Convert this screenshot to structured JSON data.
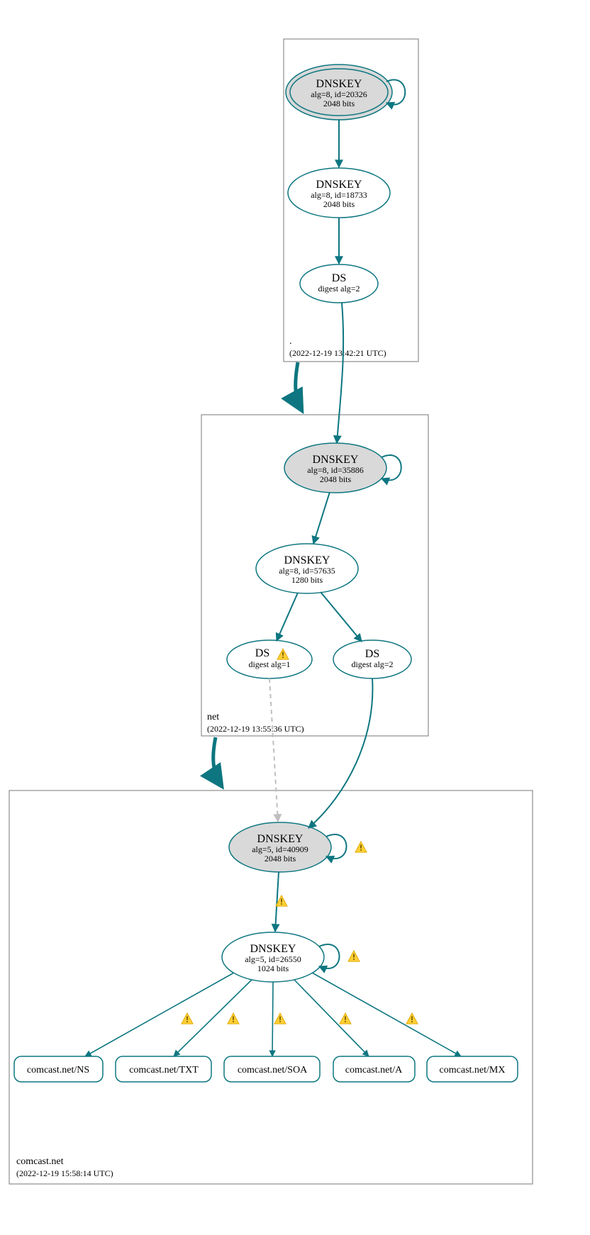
{
  "zones": {
    "root": {
      "label": ".",
      "timestamp": "(2022-12-19 13:42:21 UTC)"
    },
    "net": {
      "label": "net",
      "timestamp": "(2022-12-19 13:55:36 UTC)"
    },
    "comcast": {
      "label": "comcast.net",
      "timestamp": "(2022-12-19 15:58:14 UTC)"
    }
  },
  "nodes": {
    "root_ksk": {
      "title": "DNSKEY",
      "line2": "alg=8, id=20326",
      "line3": "2048 bits"
    },
    "root_zsk": {
      "title": "DNSKEY",
      "line2": "alg=8, id=18733",
      "line3": "2048 bits"
    },
    "root_ds": {
      "title": "DS",
      "line2": "digest alg=2"
    },
    "net_ksk": {
      "title": "DNSKEY",
      "line2": "alg=8, id=35886",
      "line3": "2048 bits"
    },
    "net_zsk": {
      "title": "DNSKEY",
      "line2": "alg=8, id=57635",
      "line3": "1280 bits"
    },
    "net_ds1": {
      "title": "DS",
      "line2": "digest alg=1"
    },
    "net_ds2": {
      "title": "DS",
      "line2": "digest alg=2"
    },
    "com_ksk": {
      "title": "DNSKEY",
      "line2": "alg=5, id=40909",
      "line3": "2048 bits"
    },
    "com_zsk": {
      "title": "DNSKEY",
      "line2": "alg=5, id=26550",
      "line3": "1024 bits"
    },
    "rr_ns": {
      "label": "comcast.net/NS"
    },
    "rr_txt": {
      "label": "comcast.net/TXT"
    },
    "rr_soa": {
      "label": "comcast.net/SOA"
    },
    "rr_a": {
      "label": "comcast.net/A"
    },
    "rr_mx": {
      "label": "comcast.net/MX"
    }
  }
}
